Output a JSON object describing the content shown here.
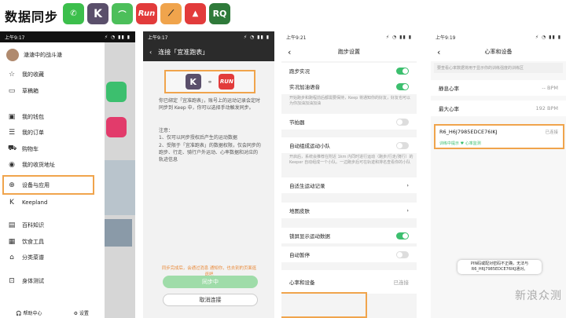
{
  "heading": "数据同步",
  "apps": [
    {
      "icon": "wechat-icon",
      "label": "",
      "color": "#3cbf4c"
    },
    {
      "icon": "keep-icon",
      "label": "K",
      "color": "#5a4f6b"
    },
    {
      "icon": "codoon-icon",
      "label": "",
      "color": "#4cbf5a"
    },
    {
      "icon": "yuepaoquan-icon",
      "label": "Run",
      "color": "#e23b3b"
    },
    {
      "icon": "strava-icon",
      "label": "",
      "color": "#f0a44c"
    },
    {
      "icon": "joyrun-icon",
      "label": "",
      "color": "#e23b3b"
    },
    {
      "icon": "rq-icon",
      "label": "RQ",
      "color": "#2f7a3a"
    }
  ],
  "phone1": {
    "time": "上午9:17",
    "username": "溏溏中的战斗溏",
    "menu": [
      "我的收藏",
      "草稿箱",
      "我的钱包",
      "我的订单",
      "购物车",
      "我的收货地址",
      "设备与应用",
      "Keepland",
      "百科知识",
      "饮食工具",
      "分类菜谱",
      "身体测试"
    ],
    "right_labels": [
      "我的课程",
      "更多",
      "课程更多"
    ],
    "footer": {
      "help": "帮助中心",
      "settings": "设置"
    }
  },
  "phone2": {
    "time": "上午9:17",
    "title": "连接「宜准跑表」",
    "intro": "你已绑定「宜准跑表」，账号上的运动记录会定时同步到 Keep 中，你可以选择手动触发同步。",
    "note_title": "注意：",
    "note1": "1、仅可以同步授权后产生的运动数据",
    "note2": "2、受限于「宜准跑表」的数据权限，仅会同步的跑步、行走、骑行户外运动、心率数据和对应的轨迹信息",
    "warn": "同步完成后，会通过消息 通知你，也去别的页面逛逛吧",
    "sync_button": "同步中",
    "cancel_button": "取消连接"
  },
  "phone3": {
    "time": "上午9:21",
    "title": "跑步设置",
    "rows": [
      {
        "label": "跑步实况",
        "toggle": "on"
      },
      {
        "label": "实况加油语音",
        "toggle": "on"
      },
      {
        "label": "节拍器",
        "toggle": "off"
      },
      {
        "label": "自动组成运动小队",
        "toggle": "off"
      },
      {
        "label": "自适生运动记录",
        "toggle": ""
      },
      {
        "label": "地图皮肤",
        "toggle": ""
      },
      {
        "label": "锁屏显示运动数据",
        "toggle": "on"
      },
      {
        "label": "自动暂停",
        "toggle": "off"
      },
      {
        "label": "心率和设备",
        "toggle": "",
        "value": "已连接"
      }
    ],
    "sub1": "开始跑步和跑程前后都需要保持，Keep 将通知你的好友，好友也可以为你加油加油加油",
    "sub2": "开启后，系统会推荐在附近 1km 内同时进行运动（跑步/行走/骑行）的 Keeper 自动组成一个小队。一边跑步后可在轨迹和排名查看你的小队"
  },
  "phone4": {
    "time": "上午9:19",
    "title": "心率和设备",
    "hint": "要查看心率数据将用于显示你的训练强度的训练区",
    "rows": [
      {
        "label": "静息心率",
        "value": "-- BPM"
      },
      {
        "label": "最大心率",
        "value": "192 BPM"
      }
    ],
    "device_name": "R6_H6J7985EDCE76IKJ",
    "device_status": "已连接",
    "device_info": "训练中提示",
    "device_hr": "心率监测",
    "toast": "PIN码或配对密码不正确，无法与 R6_H6J7985EDCE76IKJ通对。"
  },
  "watermark": "新浪众测"
}
